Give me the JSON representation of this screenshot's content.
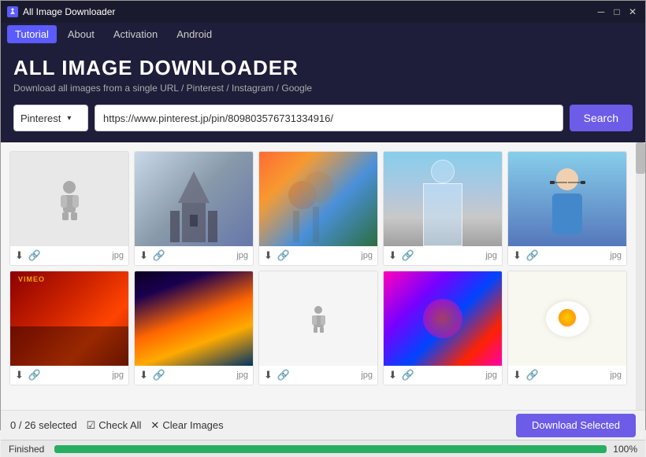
{
  "titleBar": {
    "title": "All Image Downloader",
    "iconLabel": "A",
    "minBtn": "─",
    "maxBtn": "□",
    "closeBtn": "✕"
  },
  "menuBar": {
    "items": [
      {
        "id": "tutorial",
        "label": "Tutorial",
        "active": true
      },
      {
        "id": "about",
        "label": "About",
        "active": false
      },
      {
        "id": "activation",
        "label": "Activation",
        "active": false
      },
      {
        "id": "android",
        "label": "Android",
        "active": false
      }
    ]
  },
  "header": {
    "title": "ALL IMAGE DOWNLOADER",
    "subtitle": "Download all images from a single URL / Pinterest / Instagram / Google"
  },
  "searchBar": {
    "sourceLabel": "Pinterest",
    "sourceArrow": "▾",
    "urlValue": "https://www.pinterest.jp/pin/809803576731334916/",
    "searchBtnLabel": "Search"
  },
  "images": [
    {
      "id": 1,
      "format": "jpg",
      "imgClass": "img-1"
    },
    {
      "id": 2,
      "format": "jpg",
      "imgClass": "img-2"
    },
    {
      "id": 3,
      "format": "jpg",
      "imgClass": "img-3"
    },
    {
      "id": 4,
      "format": "jpg",
      "imgClass": "img-4"
    },
    {
      "id": 5,
      "format": "jpg",
      "imgClass": "img-5"
    },
    {
      "id": 6,
      "format": "jpg",
      "imgClass": "img-6"
    },
    {
      "id": 7,
      "format": "jpg",
      "imgClass": "img-7"
    },
    {
      "id": 8,
      "format": "jpg",
      "imgClass": "img-8"
    },
    {
      "id": 9,
      "format": "jpg",
      "imgClass": "img-9"
    },
    {
      "id": 10,
      "format": "jpg",
      "imgClass": "img-10"
    }
  ],
  "bottomBar": {
    "selectedCount": "0 / 26 selected",
    "checkAllLabel": "Check All",
    "clearLabel": "Clear Images",
    "downloadBtnLabel": "Download Selected"
  },
  "progressBar": {
    "label": "Finished",
    "percent": 100,
    "percentLabel": "100%"
  }
}
